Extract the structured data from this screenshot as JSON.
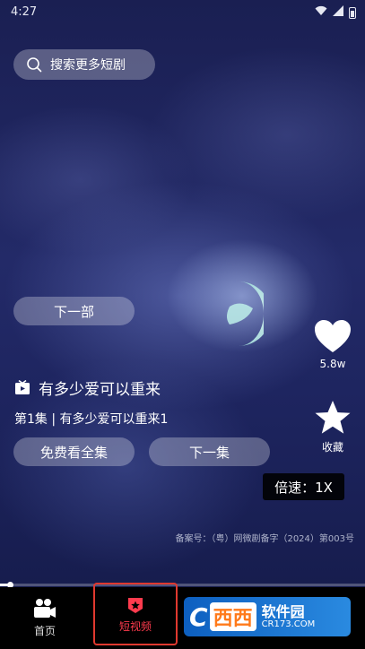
{
  "status": {
    "time": "4:27"
  },
  "search": {
    "placeholder": "搜索更多短剧"
  },
  "player": {
    "next_part": "下一部",
    "title": "有多少爱可以重来",
    "episode": "第1集 | 有多少爱可以重来1",
    "free_all": "免费看全集",
    "next_episode": "下一集",
    "likes": "5.8w",
    "favorite": "收藏",
    "speed": "倍速：1X",
    "record_no": "备案号：（粤）网微剧备字（2024）第003号",
    "progress": 0.03
  },
  "tabs": {
    "home": "首页",
    "short": "短视频"
  },
  "watermark": {
    "mark": "C",
    "brand": "西西",
    "cn": "软件园",
    "en": "CR173.COM"
  }
}
